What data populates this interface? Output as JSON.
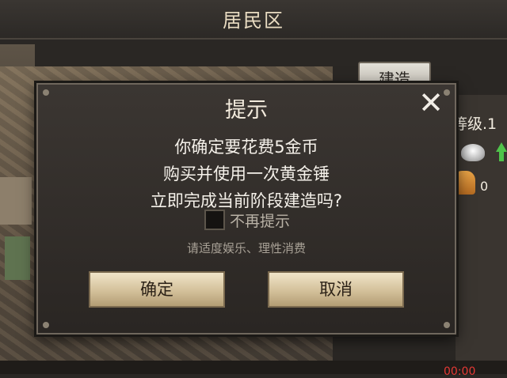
{
  "header": {
    "title": "居民区"
  },
  "toolbar": {
    "build_label": "建造"
  },
  "side_info": {
    "level_text": "等级.1",
    "worker_count": "0",
    "bottom_text": "00:00"
  },
  "dialog": {
    "title": "提示",
    "close_icon": "close-icon",
    "message_lines": [
      "你确定要花费5金币",
      "购买并使用一次黄金锤",
      "立即完成当前阶段建造吗?"
    ],
    "checkbox_label": "不再提示",
    "checkbox_checked": false,
    "advice": "请适度娱乐、理性消费",
    "confirm_label": "确定",
    "cancel_label": "取消"
  },
  "colors": {
    "background": "#2a2724",
    "dialog_bg": "#2f2b27",
    "button_gold": "#d3c09a",
    "text_light": "#f5f1ea"
  }
}
